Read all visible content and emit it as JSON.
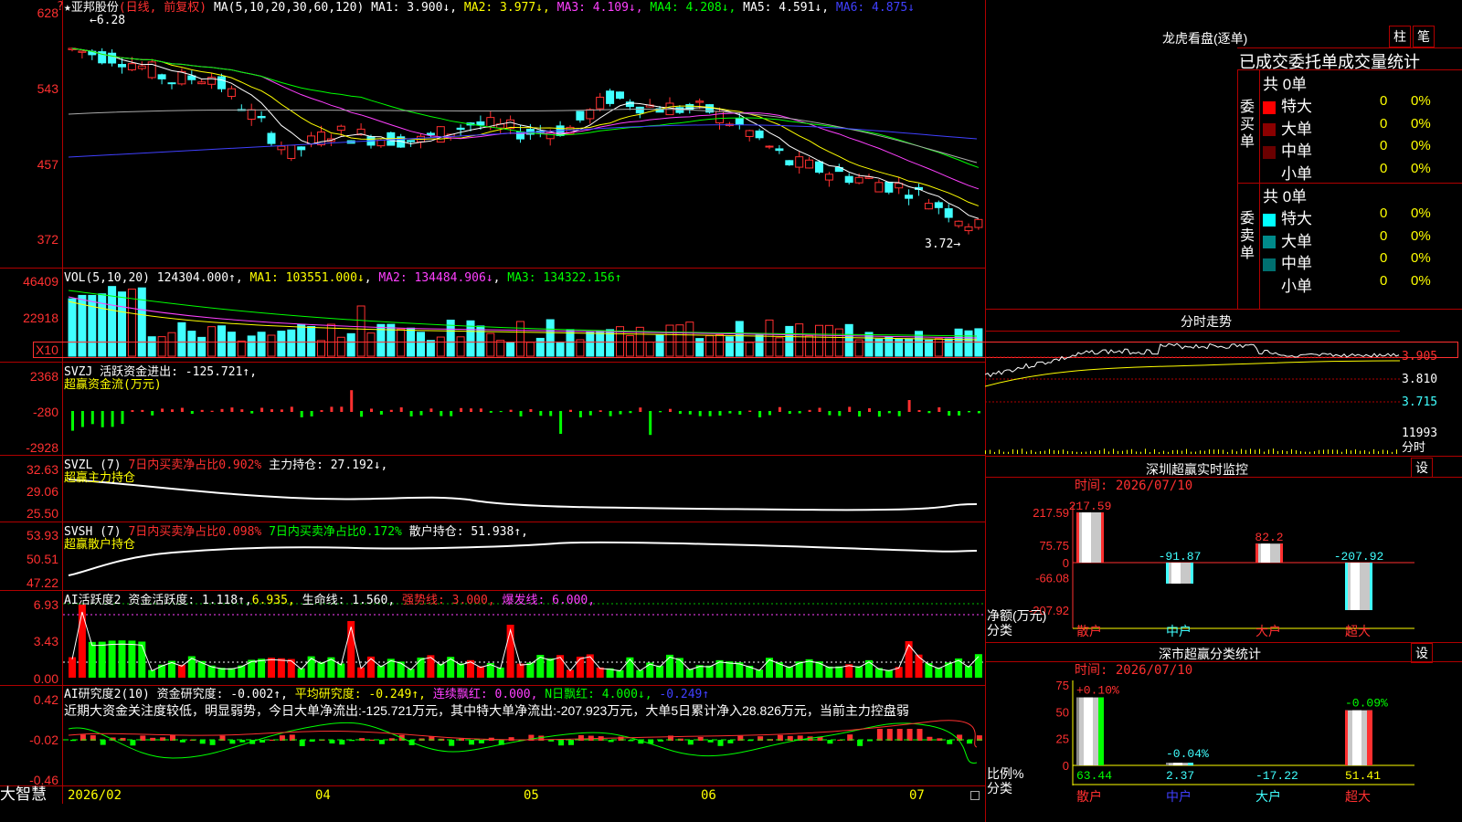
{
  "stock": {
    "name_label": "★亚邦股份",
    "period_label": "(日线, 前复权)"
  },
  "kline": {
    "ma_label": "MA(5,10,20,30,60,120)",
    "ma": [
      {
        "t": "MA1: 3.900↓",
        "c": "#ffffff"
      },
      {
        "t": "MA2: 3.977↓",
        "c": "#ffff00"
      },
      {
        "t": "MA3: 4.109↓",
        "c": "#ff40ff"
      },
      {
        "t": "MA4: 4.208↓",
        "c": "#00ff00"
      },
      {
        "t": "MA5: 4.591↓",
        "c": "#ffffff"
      },
      {
        "t": "MA6: 4.875↓",
        "c": "#4040ff"
      }
    ],
    "ticks": [
      "628",
      "543",
      "457",
      "372"
    ],
    "high_label": "6.28",
    "low_label": "3.72"
  },
  "volume": {
    "label": "VOL(5,10,20)",
    "value": "124304.000↑",
    "ma1": "MA1: 103551.000↓",
    "ma2": "MA2: 134484.906↓",
    "ma3": "MA3: 134322.156↑",
    "ticks": [
      "46409",
      "22918"
    ],
    "unit": "X10"
  },
  "svzj": {
    "label": "SVZJ",
    "desc": "活跃资金进出: -125.721↑,",
    "sub": "超赢资金流(万元)",
    "ticks": [
      "2368",
      "-280",
      "-2928"
    ]
  },
  "svzl": {
    "label": "SVZL (7)",
    "desc": "7日内买卖净占比0.902%",
    "hold": "主力持仓: 27.192↓,",
    "sub": "超赢主力持仓",
    "ticks": [
      "32.63",
      "29.06",
      "25.50"
    ]
  },
  "svsh": {
    "label": "SVSH (7)",
    "desc1": "7日内买卖净占比0.098%",
    "desc2": "7日内买卖净占比0.172%",
    "hold": "散户持仓: 51.938↑,",
    "sub": "超赢散户持仓",
    "ticks": [
      "53.93",
      "50.51",
      "47.22"
    ]
  },
  "ai1": {
    "label": "AI活跃度2",
    "v1": "资金活跃度: 1.118↑,",
    "v2": "6.935,",
    "v3": "生命线: 1.560,",
    "v4": "强势线: 3.000,",
    "v5": "爆发线: 6.000,",
    "ticks": [
      "6.93",
      "3.43",
      "0.00"
    ]
  },
  "ai2": {
    "label": "AI研究度2(10)",
    "v1": "资金研究度: -0.002↑,",
    "v2": "平均研究度: -0.249↑,",
    "v3": "连续飘红: 0.000,",
    "v4": "N日飘红: 4.000↓,",
    "v5": "-0.249↑",
    "comment": "近期大资金关注度较低，明显弱势，今日大单净流出:-125.721万元，其中特大单净流出:-207.923万元，大单5日累计净入28.826万元，当前主力控盘弱",
    "ticks": [
      "0.42",
      "-0.02",
      "-0.46"
    ]
  },
  "xaxis": {
    "dates": [
      "2026/02",
      "04",
      "05",
      "06",
      "07"
    ]
  },
  "brand": "大智慧",
  "top_marker": "?",
  "right": {
    "lhb_title": "龙虎看盘(逐单)",
    "tab_zhu": "柱",
    "tab_bi": "笔",
    "stat_title": "已成交委托单成交量统计",
    "buy": {
      "label": "委买单",
      "total": "共 0单",
      "rows": [
        {
          "n": "特大",
          "v": "0",
          "p": "0%",
          "c": "#ff0000"
        },
        {
          "n": "大单",
          "v": "0",
          "p": "0%",
          "c": "#8b0000"
        },
        {
          "n": "中单",
          "v": "0",
          "p": "0%",
          "c": "#6b0000"
        },
        {
          "n": "小单",
          "v": "0",
          "p": "0%",
          "c": "#000000"
        }
      ]
    },
    "sell": {
      "label": "委卖单",
      "total": "共 0单",
      "rows": [
        {
          "n": "特大",
          "v": "0",
          "p": "0%",
          "c": "#00ffff"
        },
        {
          "n": "大单",
          "v": "0",
          "p": "0%",
          "c": "#008b8b"
        },
        {
          "n": "中单",
          "v": "0",
          "p": "0%",
          "c": "#007070"
        },
        {
          "n": "小单",
          "v": "0",
          "p": "0%",
          "c": "#000000"
        }
      ]
    },
    "fs_title": "分时走势",
    "fs_ticks": [
      "3.905",
      "3.810",
      "3.715",
      "11993"
    ],
    "fs_bottom": "分时",
    "sz_title": "深圳超赢实时监控",
    "sz_time": "时间: 2026/07/10",
    "sz_set": "设",
    "sz_ticks": [
      "217.59",
      "75.75",
      "0",
      "-66.08",
      "-207.92"
    ],
    "sz_unit": "净额(万元)",
    "sz_cat": "分类",
    "sz_bars": [
      {
        "name": "散户",
        "label": "217.59",
        "v": 217.59
      },
      {
        "name": "中户",
        "label": "-91.87",
        "v": -91.87
      },
      {
        "name": "大户",
        "label": "82.2",
        "v": 82.2
      },
      {
        "name": "超大",
        "label": "-207.92",
        "v": -207.92
      }
    ],
    "sc_title": "深市超赢分类统计",
    "sc_time": "时间: 2026/07/10",
    "sc_set": "设",
    "sc_ticks": [
      "75",
      "50",
      "25",
      "0"
    ],
    "sc_unit": "比例%",
    "sc_cat": "分类",
    "sc_bars": [
      {
        "name": "散户",
        "top": "+0.10%",
        "bottom": "63.44",
        "v": 63.44
      },
      {
        "name": "中户",
        "top": "-0.04%",
        "bottom": "2.37",
        "v": 2.37
      },
      {
        "name": "大户",
        "top": "",
        "bottom": "-17.22",
        "v": 0
      },
      {
        "name": "超大",
        "top": "-0.09%",
        "bottom": "51.41",
        "v": 51.41
      }
    ]
  },
  "colors": {
    "up": "#ff3030",
    "down": "#40ffff",
    "border": "#b00000"
  }
}
